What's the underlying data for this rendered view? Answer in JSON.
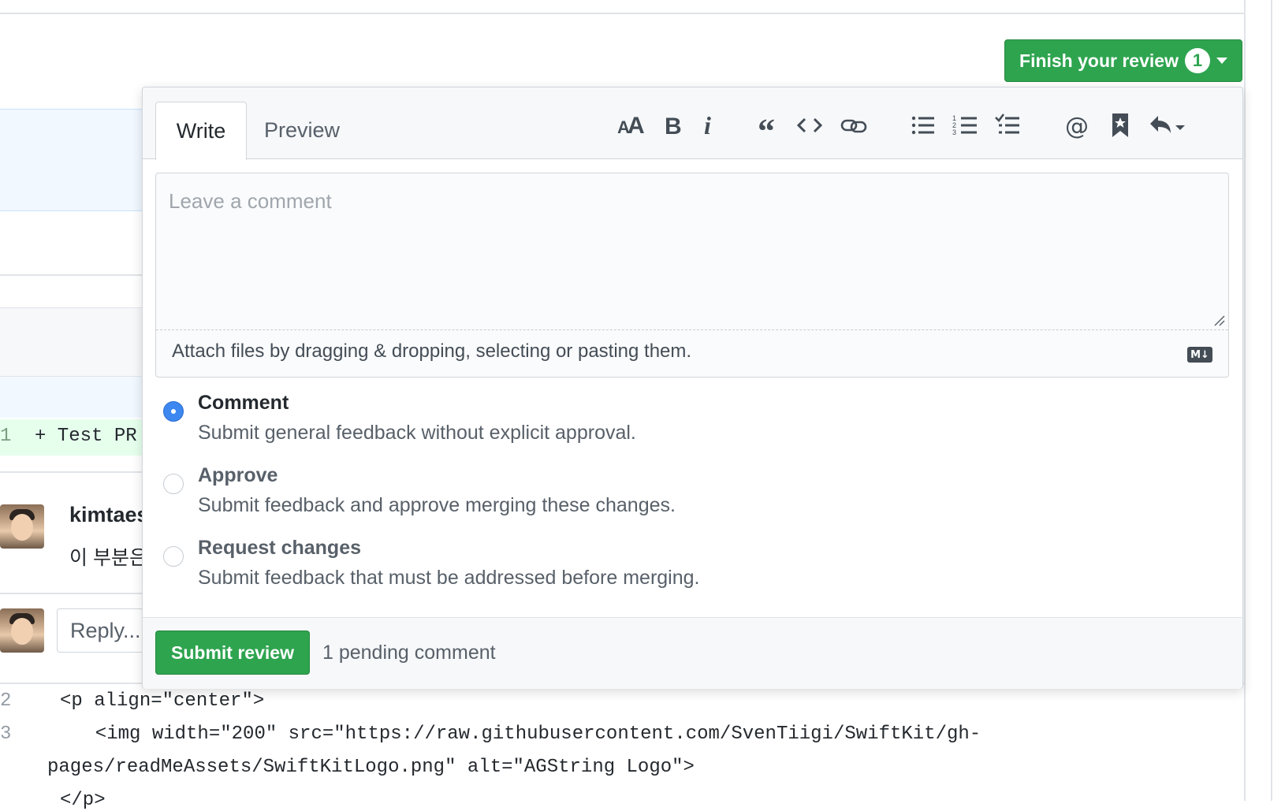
{
  "header": {
    "finish_button_label": "Finish your review",
    "pending_count": "1"
  },
  "diff": {
    "added_line": "+ Test PR",
    "code_lines": [
      "<p align=\"center\">",
      "  <img width=\"200\" src=\"https://raw.githubusercontent.com/SvenTiigi/SwiftKit/gh-",
      "pages/readMeAssets/SwiftKitLogo.png\" alt=\"AGString Logo\">",
      "</p>"
    ],
    "line_numbers": [
      "1",
      "2",
      "3"
    ]
  },
  "thread": {
    "author": "kimtaes",
    "comment_text": "이 부분은",
    "reply_placeholder": "Reply..."
  },
  "review_popover": {
    "tabs": [
      "Write",
      "Preview"
    ],
    "toolbar_icons": [
      "text-size-icon",
      "bold-icon",
      "italic-icon",
      "quote-icon",
      "code-icon",
      "link-icon",
      "bullet-list-icon",
      "numbered-list-icon",
      "task-list-icon",
      "mention-icon",
      "saved-reply-icon",
      "reply-dropdown-icon"
    ],
    "comment_placeholder": "Leave a comment",
    "attach_text": "Attach files by dragging & dropping, selecting or pasting them.",
    "markdown_badge": "M↓",
    "options": [
      {
        "title": "Comment",
        "desc": "Submit general feedback without explicit approval.",
        "checked": true
      },
      {
        "title": "Approve",
        "desc": "Submit feedback and approve merging these changes.",
        "checked": false
      },
      {
        "title": "Request changes",
        "desc": "Submit feedback that must be addressed before merging.",
        "checked": false
      }
    ],
    "submit_label": "Submit review",
    "pending_text": "1 pending comment"
  },
  "colors": {
    "primary_green": "#2ea44f",
    "radio_blue": "#3c87f0",
    "diff_added_bg": "#e6ffed",
    "hunk_bg": "#f1f8ff"
  }
}
